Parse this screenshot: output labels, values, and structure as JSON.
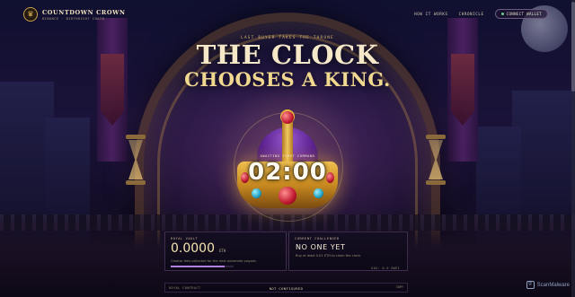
{
  "brand": {
    "logo_glyph": "♛",
    "name": "COUNTDOWN CROWN",
    "subtitle": "BINANCE · BIRTHRIGHT CHAIN"
  },
  "nav": {
    "how_it_works": "HOW IT WORKS",
    "chronicle": "CHRONICLE",
    "connect_wallet": "CONNECT WALLET"
  },
  "hero": {
    "tagline": "LAST BUYER TAKES THE THRONE",
    "headline_line1": "THE CLOCK",
    "headline_line2": "CHOOSES A KING."
  },
  "timer": {
    "label": "AWAITING FIRST COMMAND",
    "value": "02:00"
  },
  "vault": {
    "label": "ROYAL VAULT",
    "value": "0.0000",
    "unit": "ETH",
    "note": "Creator fees collected for the next automatic payout.",
    "progress": 0.85
  },
  "challenger": {
    "label": "CURRENT CHALLENGER",
    "value": "NO ONE YET",
    "note": "Buy at least 0.01 ETH to claim the clock.",
    "gas": "GAS: 0.0 GWEI"
  },
  "contract": {
    "label": "ROYAL CONTRACT",
    "value": "NOT CONFIGURED",
    "copy": "COPY"
  },
  "watermark": "ScanMalware",
  "colors": {
    "accent_gold": "#f0d890",
    "vault_bar": "#b080e0",
    "background": "#0a0818"
  }
}
